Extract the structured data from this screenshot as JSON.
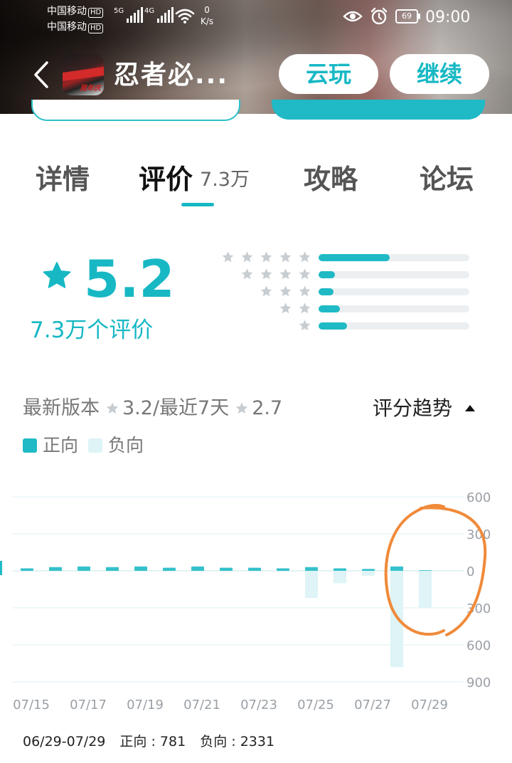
{
  "status_bar": {
    "carrier1": "中国移动",
    "carrier2": "中国移动",
    "hd_label": "HD",
    "net1": "5G",
    "net2": "4G",
    "speed_value": "0",
    "speed_unit": "K/s",
    "battery": "69",
    "time": "09:00"
  },
  "header": {
    "app_title": "忍者必...",
    "app_icon_text": "周年庆",
    "cloud_play_label": "云玩",
    "continue_label": "继续"
  },
  "tabs": [
    {
      "label": "详情"
    },
    {
      "label": "评价",
      "count": "7.3万",
      "active": true
    },
    {
      "label": "攻略"
    },
    {
      "label": "论坛"
    }
  ],
  "score": {
    "value": "5.2",
    "count_label": "7.3万个评价",
    "distribution": [
      {
        "stars": 5,
        "fraction": 0.47
      },
      {
        "stars": 4,
        "fraction": 0.11
      },
      {
        "stars": 3,
        "fraction": 0.1
      },
      {
        "stars": 2,
        "fraction": 0.14
      },
      {
        "stars": 1,
        "fraction": 0.19
      }
    ]
  },
  "trend": {
    "latest_label": "最新版本",
    "latest_score": "3.2",
    "recent_label": "/最近7天",
    "recent_score": "2.7",
    "toggle_label": "评分趋势",
    "legend_positive": "正向",
    "legend_negative": "负向",
    "footer_range": "06/29-07/29",
    "footer_positive": "正向 : 781",
    "footer_negative": "负向 : 2331"
  },
  "colors": {
    "accent": "#17b8c4",
    "positive_bar": "#1fbac5",
    "negative_bar": "#def4f6",
    "annotation": "#f08a3a"
  },
  "chart_data": {
    "type": "bar",
    "x": [
      "07/15",
      "07/16",
      "07/17",
      "07/18",
      "07/19",
      "07/20",
      "07/21",
      "07/22",
      "07/23",
      "07/24",
      "07/25",
      "07/26",
      "07/27",
      "07/28",
      "07/29"
    ],
    "xtick_labels": [
      "07/15",
      "07/17",
      "07/19",
      "07/21",
      "07/23",
      "07/25",
      "07/27",
      "07/29"
    ],
    "ytick_labels": [
      "600",
      "300",
      "0",
      "300",
      "600",
      "900"
    ],
    "ylim": [
      -900,
      600
    ],
    "series": [
      {
        "name": "正向",
        "values": [
          20,
          30,
          35,
          30,
          35,
          25,
          35,
          25,
          25,
          20,
          30,
          20,
          15,
          35,
          5
        ]
      },
      {
        "name": "负向",
        "values": [
          0,
          0,
          0,
          0,
          0,
          0,
          0,
          0,
          0,
          0,
          -220,
          -100,
          -40,
          -780,
          -300
        ]
      }
    ],
    "grid": true,
    "annotation": "hand-drawn orange circle around 07/28"
  }
}
